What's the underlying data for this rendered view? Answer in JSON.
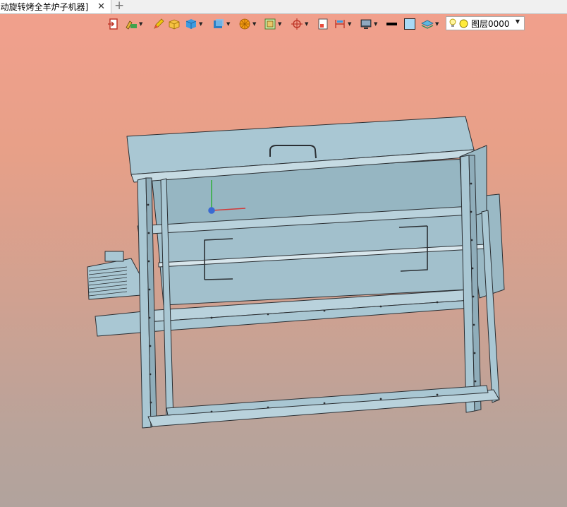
{
  "tab": {
    "title": "[动旋转烤全羊炉子机器]",
    "close": "✕",
    "add": "+"
  },
  "toolbar": {
    "layer_value": "图层0000",
    "icons": [
      "exit-sketch-icon",
      "style-brush-icon",
      "pencil-icon",
      "pack-icon",
      "solid-box-icon",
      "blue-box-icon",
      "orange-wheel-icon",
      "view-frame-icon",
      "locate-crosshair-icon",
      "panel-icon",
      "dimension-icon",
      "monitor-icon",
      "line-color-swatch",
      "fill-color-swatch",
      "layers-icon",
      "bulb-icon",
      "layer-state-icon"
    ]
  },
  "colors": {
    "model": "#a9c7d3",
    "model_edge": "#2b2f33",
    "bg_top": "#f2a08d",
    "bg_bottom": "#b1a39d"
  }
}
